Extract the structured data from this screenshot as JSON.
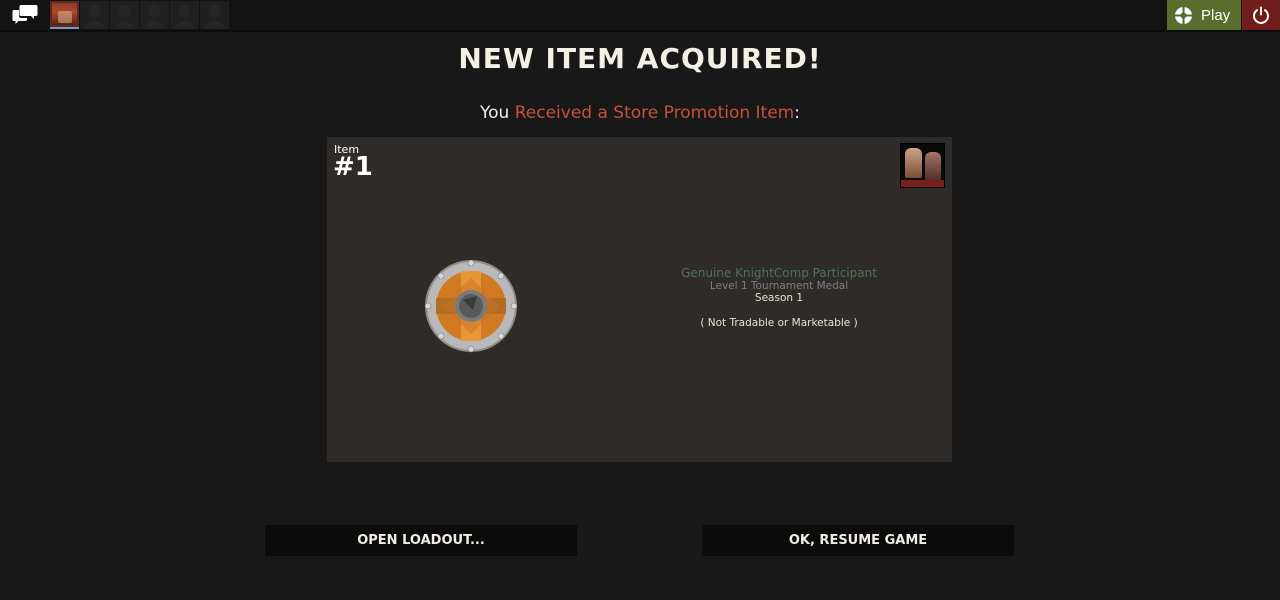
{
  "topbar": {
    "play_label": "Play",
    "friend_slots": 6
  },
  "dialog": {
    "title": "NEW ITEM ACQUIRED!",
    "subtitle_prefix": "You ",
    "subtitle_highlight": "Received a Store Promotion Item",
    "subtitle_suffix": ":"
  },
  "item": {
    "label": "Item",
    "number": "#1",
    "name": "Genuine KnightComp Participant",
    "level": "Level 1 Tournament Medal",
    "season": "Season 1",
    "tradability": "( Not Tradable or Marketable )"
  },
  "buttons": {
    "loadout": "OPEN LOADOUT...",
    "resume": "OK, RESUME GAME"
  },
  "colors": {
    "promo_text": "#c8513b",
    "genuine_quality": "#4d7455",
    "play_button": "#5a6d2c",
    "power_button": "#6e1c1c"
  }
}
